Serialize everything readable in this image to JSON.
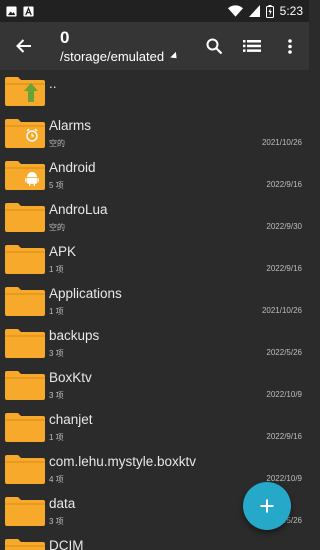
{
  "status_bar": {
    "time": "5:23",
    "icons": [
      "image-icon",
      "a-icon",
      "wifi-icon",
      "battery-charging-icon",
      "signal-icon"
    ]
  },
  "app_bar": {
    "title": "0",
    "path": "/storage/emulated",
    "actions": [
      "search-icon",
      "list-view-icon",
      "more-options-icon"
    ]
  },
  "list": {
    "parent": "..",
    "items": [
      {
        "name": "Alarms",
        "meta": "空的",
        "date": "2021/10/26",
        "badge": "alarm-icon"
      },
      {
        "name": "Android",
        "meta": "5 项",
        "date": "2022/9/16",
        "badge": "android-icon"
      },
      {
        "name": "AndroLua",
        "meta": "空的",
        "date": "2022/9/30",
        "badge": ""
      },
      {
        "name": "APK",
        "meta": "1 项",
        "date": "2022/9/16",
        "badge": ""
      },
      {
        "name": "Applications",
        "meta": "1 项",
        "date": "2021/10/26",
        "badge": ""
      },
      {
        "name": "backups",
        "meta": "3 项",
        "date": "2022/5/26",
        "badge": ""
      },
      {
        "name": "BoxKtv",
        "meta": "3 项",
        "date": "2022/10/9",
        "badge": ""
      },
      {
        "name": "chanjet",
        "meta": "1 项",
        "date": "2022/9/16",
        "badge": ""
      },
      {
        "name": "com.lehu.mystyle.boxktv",
        "meta": "4 项",
        "date": "2022/10/9",
        "badge": ""
      },
      {
        "name": "data",
        "meta": "3 项",
        "date": "2022/5/26",
        "badge": ""
      },
      {
        "name": "DCIM",
        "meta": "",
        "date": "",
        "badge": ""
      }
    ]
  },
  "fab": {
    "icon": "plus-icon"
  },
  "colors": {
    "background": "#2b2b2b",
    "appbar": "#353535",
    "folder": "#f6a92a",
    "accent": "#26a9c8"
  }
}
